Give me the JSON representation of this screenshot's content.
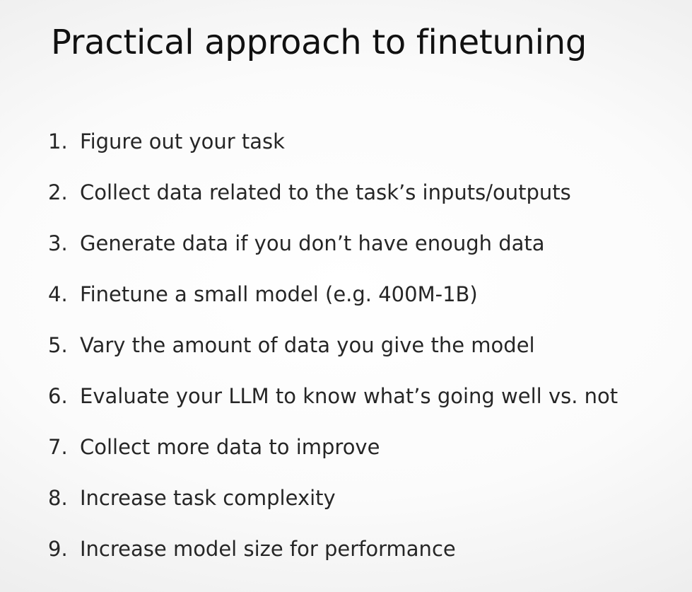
{
  "slide": {
    "title": "Practical approach to finetuning",
    "steps": [
      {
        "number": "1.",
        "text": "Figure out your task"
      },
      {
        "number": "2.",
        "text": "Collect data related to the task’s inputs/outputs"
      },
      {
        "number": "3.",
        "text": "Generate data if you don’t have enough data"
      },
      {
        "number": "4.",
        "text": "Finetune a small model (e.g. 400M-1B)"
      },
      {
        "number": "5.",
        "text": "Vary the amount of data you give the model"
      },
      {
        "number": "6.",
        "text": "Evaluate your LLM to know what’s going well vs. not"
      },
      {
        "number": "7.",
        "text": "Collect more data to improve"
      },
      {
        "number": "8.",
        "text": "Increase task complexity"
      },
      {
        "number": "9.",
        "text": "Increase model size for performance"
      }
    ]
  },
  "colors": {
    "title_text": "#111111",
    "body_text": "#262626",
    "background_center": "#ffffff",
    "background_edge": "#d6d6d6"
  }
}
